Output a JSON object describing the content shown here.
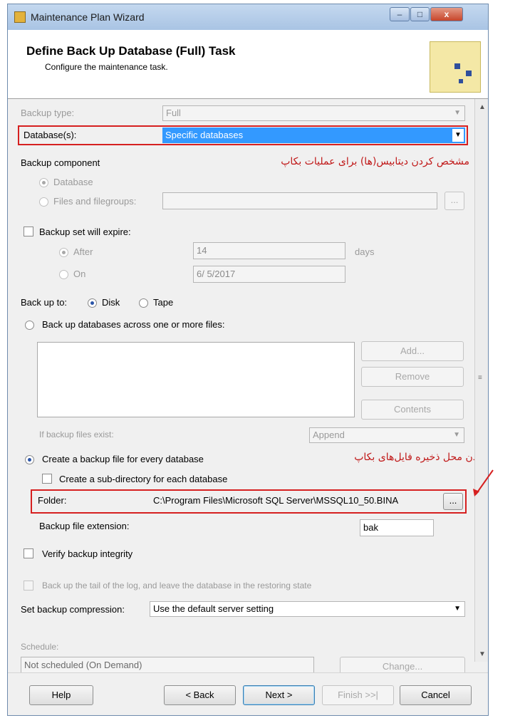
{
  "window": {
    "title": "Maintenance Plan Wizard",
    "controls": {
      "minimize": "–",
      "maximize": "□",
      "close": "x"
    }
  },
  "header": {
    "title": "Define Back Up Database (Full) Task",
    "subtitle": "Configure the maintenance task."
  },
  "form": {
    "backup_type_label": "Backup type:",
    "backup_type_value": "Full",
    "databases_label": "Database(s):",
    "databases_value": "Specific databases",
    "annotation_databases": "مشخص کردن دیتابیس(ها) برای عملیات بکاپ",
    "backup_component_label": "Backup component",
    "component_database": "Database",
    "component_files": "Files and filegroups:",
    "expire_label": "Backup set will expire:",
    "after_label": "After",
    "after_value": "14",
    "days_label": "days",
    "on_label": "On",
    "on_value": "6/ 5/2017",
    "backup_to_label": "Back up to:",
    "disk_label": "Disk",
    "tape_label": "Tape",
    "across_files_label": "Back up databases across one or more files:",
    "add_button": "Add...",
    "remove_button": "Remove",
    "contents_button": "Contents",
    "if_exist_label": "If backup files exist:",
    "if_exist_value": "Append",
    "create_file_label": "Create a backup file for every database",
    "annotation_folder": "مشخص کردن محل ذخیره فایل‌های بکاپ",
    "subdir_label": "Create a sub-directory for each database",
    "folder_label": "Folder:",
    "folder_value": "C:\\Program Files\\Microsoft SQL Server\\MSSQL10_50.BINA",
    "folder_browse": "...",
    "extension_label": "Backup file extension:",
    "extension_value": "bak",
    "verify_label": "Verify backup integrity",
    "tail_log_label": "Back up the tail of the log, and leave the database in the restoring state",
    "compression_label": "Set backup compression:",
    "compression_value": "Use the default server setting",
    "schedule_label": "Schedule:",
    "schedule_value": "Not scheduled (On Demand)",
    "change_button": "Change..."
  },
  "footer": {
    "help": "Help",
    "back": "< Back",
    "next": "Next >",
    "finish": "Finish >>|",
    "cancel": "Cancel"
  },
  "colors": {
    "annotation": "#d62020",
    "selection": "#3399ff"
  }
}
